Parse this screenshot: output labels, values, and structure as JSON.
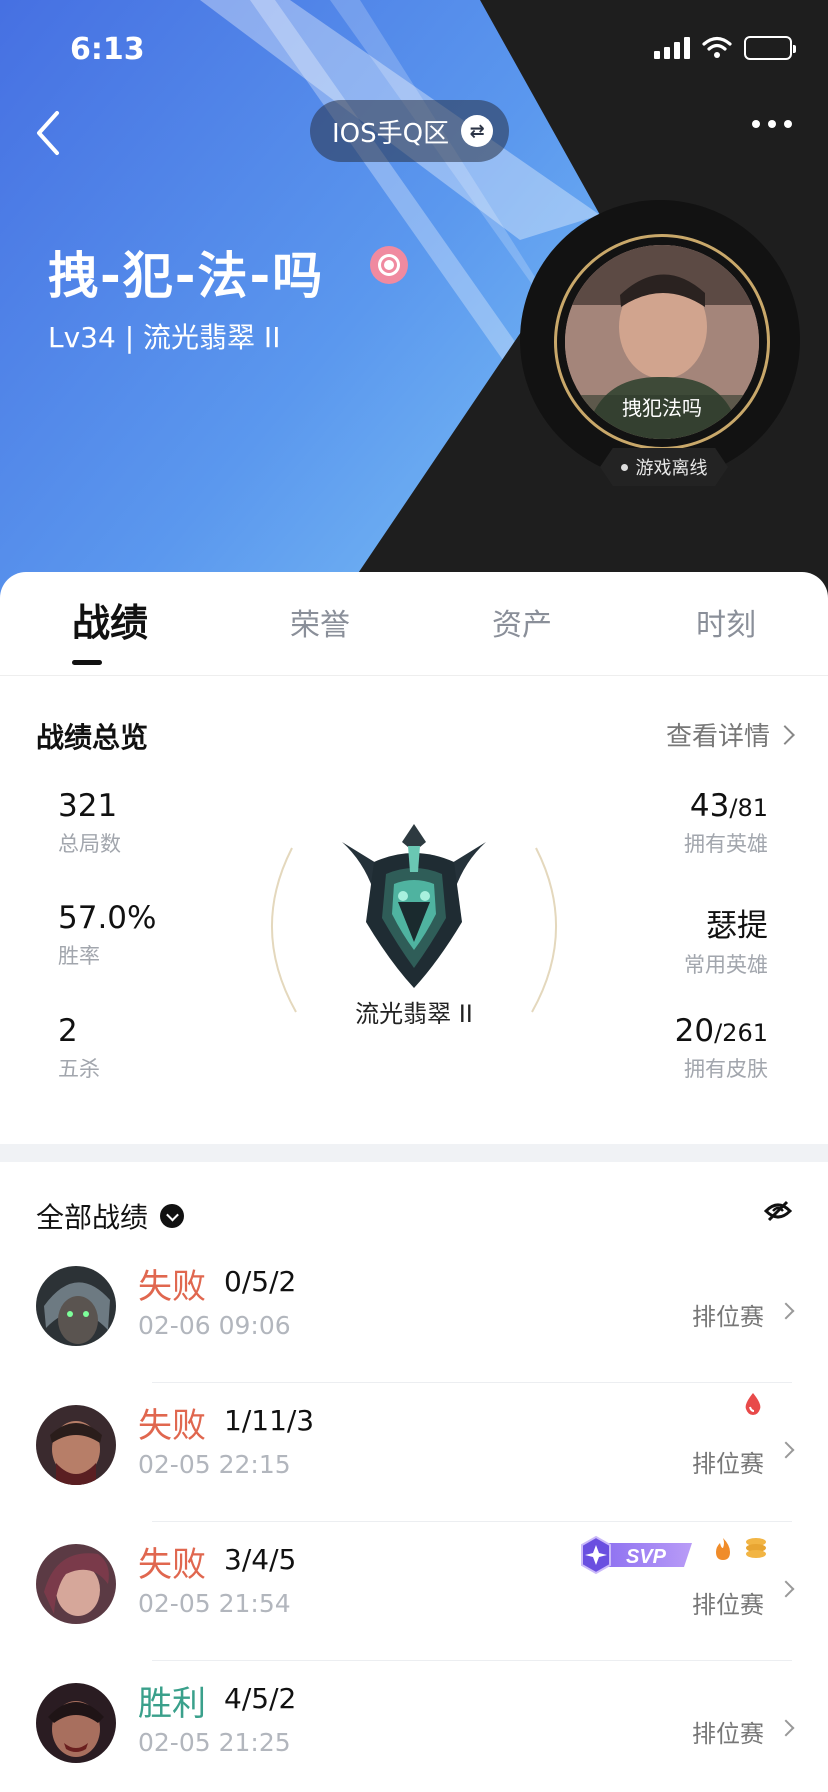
{
  "status_bar": {
    "time": "6:13"
  },
  "header": {
    "server": "IOS手Q区",
    "player_name": "拽-犯-法-吗",
    "level_line": "Lv34 | 流光翡翠 II",
    "avatar_caption": "拽犯法吗",
    "online_status": "游戏离线"
  },
  "tabs": [
    {
      "label": "战绩",
      "active": true
    },
    {
      "label": "荣誉",
      "active": false
    },
    {
      "label": "资产",
      "active": false
    },
    {
      "label": "时刻",
      "active": false
    }
  ],
  "overview": {
    "title": "战绩总览",
    "link": "查看详情",
    "rank": "流光翡翠 II",
    "left": [
      {
        "value": "321",
        "label": "总局数"
      },
      {
        "value": "57.0%",
        "label": "胜率"
      },
      {
        "value": "2",
        "label": "五杀"
      }
    ],
    "right": [
      {
        "value": "43",
        "total": "/81",
        "label": "拥有英雄"
      },
      {
        "value": "瑟提",
        "total": "",
        "label": "常用英雄"
      },
      {
        "value": "20",
        "total": "/261",
        "label": "拥有皮肤"
      }
    ]
  },
  "matches_header": {
    "title": "全部战绩"
  },
  "matches": [
    {
      "result": "失败",
      "kda": "0/5/2",
      "time": "02-06 09:06",
      "mode": "排位赛"
    },
    {
      "result": "失败",
      "kda": "1/11/3",
      "time": "02-05 22:15",
      "mode": "排位赛"
    },
    {
      "result": "失败",
      "kda": "3/4/5",
      "time": "02-05 21:54",
      "mode": "排位赛",
      "badge": "SVP"
    },
    {
      "result": "胜利",
      "kda": "4/5/2",
      "time": "02-05 21:25",
      "mode": "排位赛"
    }
  ],
  "colors": {
    "lose": "#e0674f",
    "win": "#3aa08b",
    "header_blue": "#4a78e6",
    "header_dark": "#1f1f1f"
  }
}
